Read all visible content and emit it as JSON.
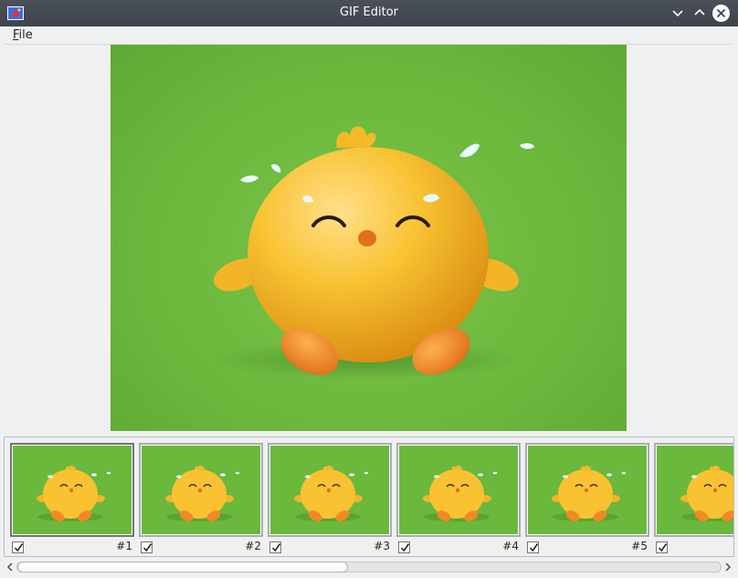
{
  "window": {
    "title": "GIF Editor"
  },
  "menu": {
    "items": [
      {
        "mnemonic": "F",
        "rest": "ile"
      }
    ]
  },
  "preview": {
    "icon": "chick-character"
  },
  "frames": [
    {
      "number": "#1",
      "checked": true,
      "selected": true
    },
    {
      "number": "#2",
      "checked": true,
      "selected": false
    },
    {
      "number": "#3",
      "checked": true,
      "selected": false
    },
    {
      "number": "#4",
      "checked": true,
      "selected": false
    },
    {
      "number": "#5",
      "checked": true,
      "selected": false
    },
    {
      "number": "",
      "checked": true,
      "selected": false
    }
  ],
  "scrollbar": {
    "position_fraction": 0.0,
    "visible_fraction": 0.47
  },
  "colors": {
    "background": "#6ab83c",
    "chick": "#f5b928",
    "feet": "#f08a24"
  }
}
